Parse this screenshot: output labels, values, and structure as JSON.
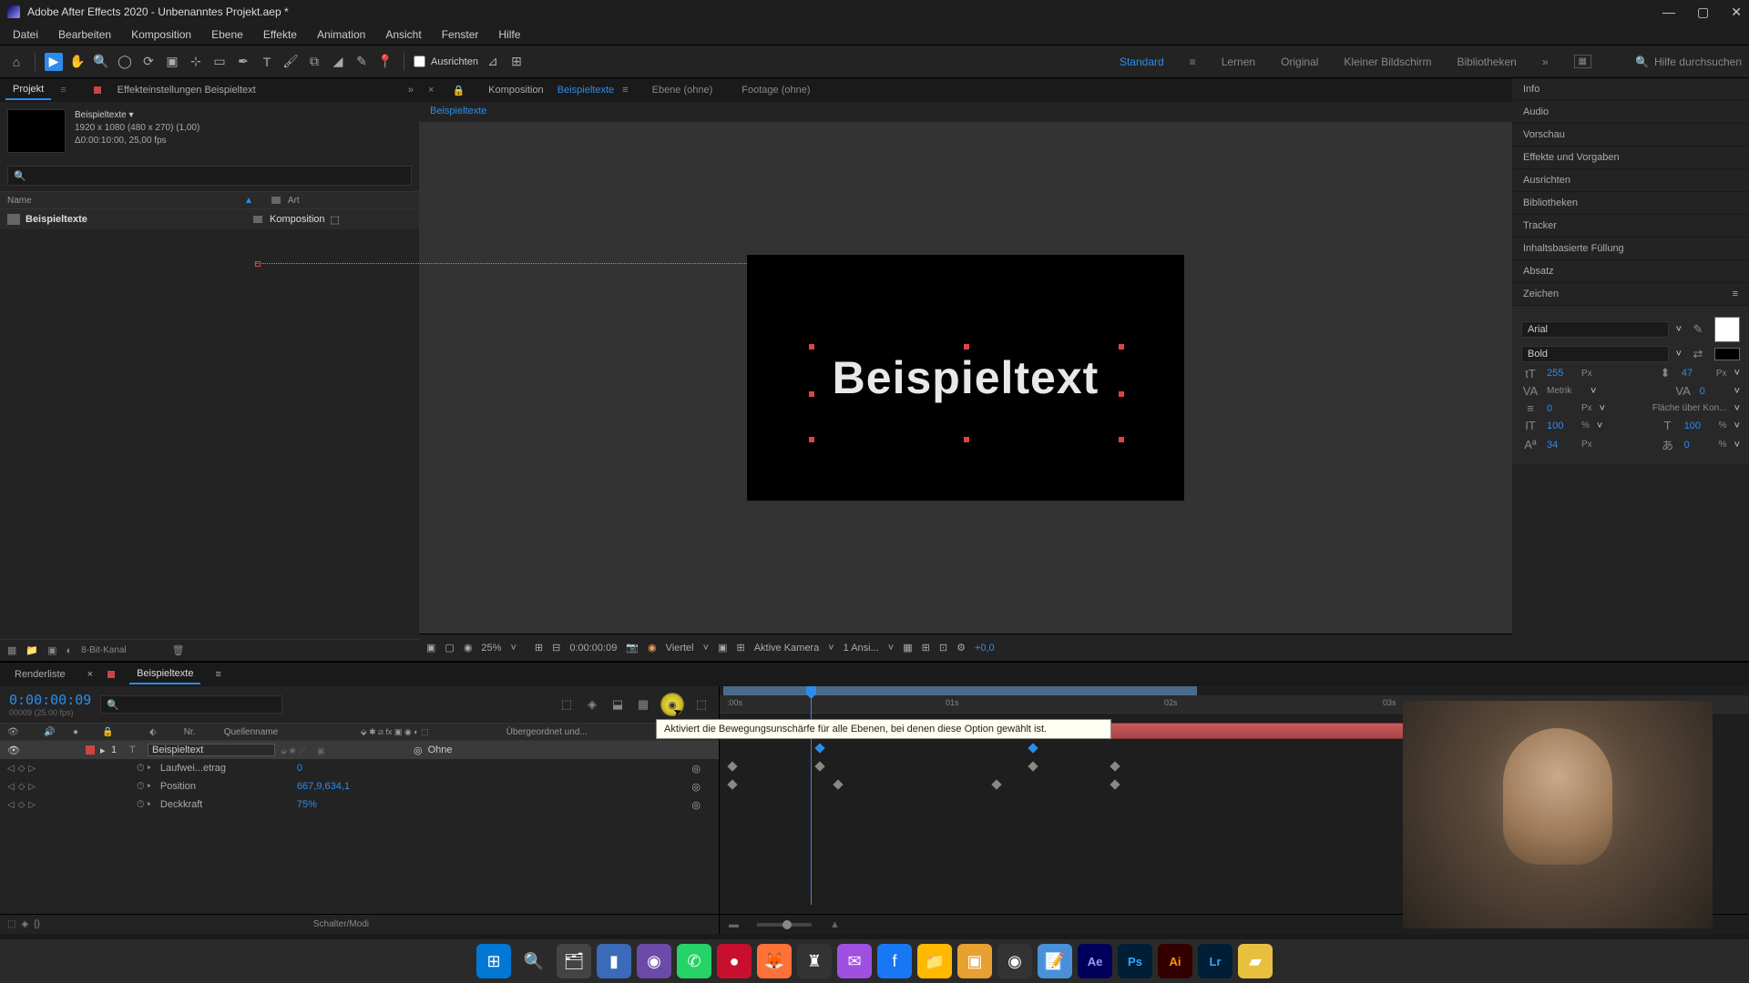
{
  "title": "Adobe After Effects 2020 - Unbenanntes Projekt.aep *",
  "menu": [
    "Datei",
    "Bearbeiten",
    "Komposition",
    "Ebene",
    "Effekte",
    "Animation",
    "Ansicht",
    "Fenster",
    "Hilfe"
  ],
  "toolbar": {
    "align": "Ausrichten",
    "workspaces": [
      "Standard",
      "Lernen",
      "Original",
      "Kleiner Bildschirm",
      "Bibliotheken"
    ],
    "active_ws": "Standard",
    "search_help": "Hilfe durchsuchen"
  },
  "project": {
    "tab": "Projekt",
    "effects_tab": "Effekteinstellungen Beispieltext",
    "comp_name": "Beispieltexte",
    "meta1": "1920 x 1080 (480 x 270) (1,00)",
    "meta2": "Δ0:00:10:00, 25,00 fps",
    "col_name": "Name",
    "col_type": "Art",
    "row_name": "Beispieltexte",
    "row_type": "Komposition"
  },
  "comp_panel": {
    "tab_comp_label": "Komposition",
    "tab_comp_name": "Beispieltexte",
    "tab_layer": "Ebene (ohne)",
    "tab_footage": "Footage (ohne)",
    "crumb": "Beispieltexte",
    "preview_text": "Beispieltext",
    "zoom": "25%",
    "timecode": "0:00:00:09",
    "resolution": "Viertel",
    "camera": "Aktive Kamera",
    "views": "1 Ansi...",
    "exposure": "+0,0",
    "bit": "8-Bit-Kanal"
  },
  "right_panels": [
    "Info",
    "Audio",
    "Vorschau",
    "Effekte und Vorgaben",
    "Ausrichten",
    "Bibliotheken",
    "Tracker",
    "Inhaltsbasierte Füllung",
    "Absatz"
  ],
  "char": {
    "title": "Zeichen",
    "font": "Arial",
    "weight": "Bold",
    "size": "255",
    "size_unit": "Px",
    "leading": "47",
    "leading_unit": "Px",
    "kerning": "Metrik",
    "tracking": "0",
    "stroke": "0",
    "stroke_unit": "Px",
    "stroke_opt": "Fläche über Kon...",
    "vscale": "100",
    "hscale": "100",
    "baseline": "34",
    "baseline_unit": "Px",
    "tsume": "0",
    "pct": "%"
  },
  "timeline": {
    "tab_render": "Renderliste",
    "tab_comp": "Beispieltexte",
    "timecode": "0:00:00:09",
    "frameinfo": "00009 (25.00 fps)",
    "col_nr": "Nr.",
    "col_src": "Quellenname",
    "col_parent": "Übergeordnet und...",
    "layer_nr": "1",
    "layer_name": "Beispieltext",
    "parent": "Ohne",
    "prop1": "Laufwei...etrag",
    "prop1_val": "0",
    "prop2": "Position",
    "prop2_val": "667,9,634,1",
    "prop3": "Deckkraft",
    "prop3_val": "75%",
    "switcher": "Schalter/Modi",
    "ruler": [
      ":00s",
      "01s",
      "02s",
      "03s"
    ],
    "tooltip": "Aktiviert die Bewegungsunschärfe für alle Ebenen, bei denen diese Option gewählt ist."
  }
}
